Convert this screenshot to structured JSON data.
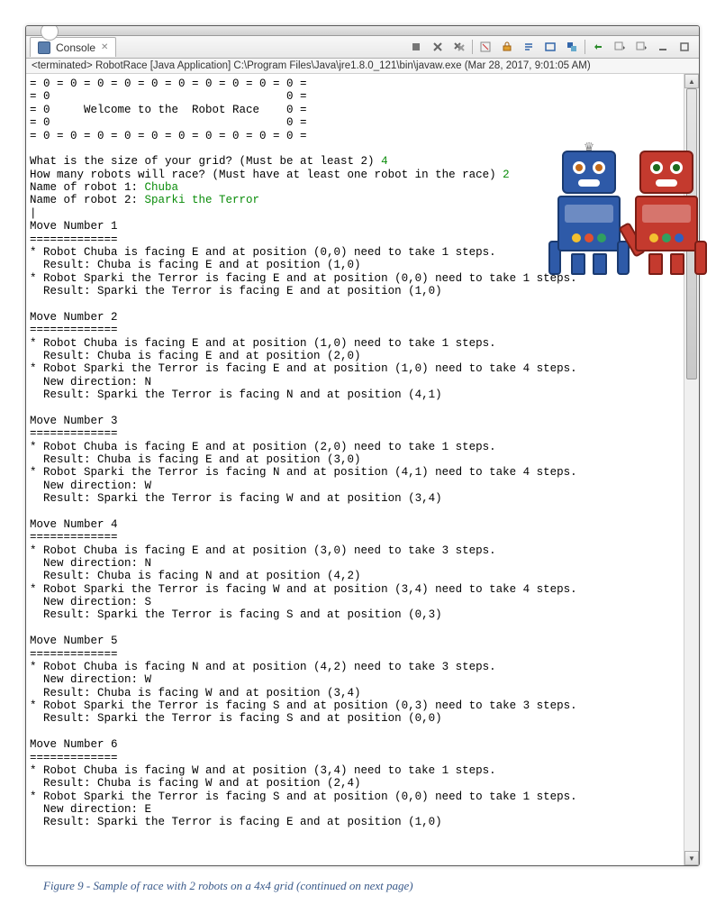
{
  "tab": {
    "label": "Console"
  },
  "process_line": "<terminated> RobotRace [Java Application] C:\\Program Files\\Java\\jre1.8.0_121\\bin\\javaw.exe (Mar 28, 2017, 9:01:05 AM)",
  "banner": {
    "l1": "= 0 = 0 = 0 = 0 = 0 = 0 = 0 = 0 = 0 = 0 =",
    "l2": "= 0                                   0 =",
    "l3": "= 0     Welcome to the  Robot Race    0 =",
    "l4": "= 0                                   0 =",
    "l5": "= 0 = 0 = 0 = 0 = 0 = 0 = 0 = 0 = 0 = 0 ="
  },
  "prompts": {
    "grid_q": "What is the size of your grid? (Must be at least 2) ",
    "grid_a": "4",
    "robots_q": "How many robots will race? (Must have at least one robot in the race) ",
    "robots_a": "2",
    "name1_q": "Name of robot 1: ",
    "name1_a": "Chuba",
    "name2_q": "Name of robot 2: ",
    "name2_a": "Sparki the Terror"
  },
  "cursor": "|",
  "sep": "=============",
  "moves": [
    {
      "title": "Move Number 1",
      "lines": [
        "* Robot Chuba is facing E and at position (0,0) need to take 1 steps.",
        "  Result: Chuba is facing E and at position (1,0)",
        "* Robot Sparki the Terror is facing E and at position (0,0) need to take 1 steps.",
        "  Result: Sparki the Terror is facing E and at position (1,0)"
      ]
    },
    {
      "title": "Move Number 2",
      "lines": [
        "* Robot Chuba is facing E and at position (1,0) need to take 1 steps.",
        "  Result: Chuba is facing E and at position (2,0)",
        "* Robot Sparki the Terror is facing E and at position (1,0) need to take 4 steps.",
        "  New direction: N",
        "  Result: Sparki the Terror is facing N and at position (4,1)"
      ]
    },
    {
      "title": "Move Number 3",
      "lines": [
        "* Robot Chuba is facing E and at position (2,0) need to take 1 steps.",
        "  Result: Chuba is facing E and at position (3,0)",
        "* Robot Sparki the Terror is facing N and at position (4,1) need to take 4 steps.",
        "  New direction: W",
        "  Result: Sparki the Terror is facing W and at position (3,4)"
      ]
    },
    {
      "title": "Move Number 4",
      "lines": [
        "* Robot Chuba is facing E and at position (3,0) need to take 3 steps.",
        "  New direction: N",
        "  Result: Chuba is facing N and at position (4,2)",
        "* Robot Sparki the Terror is facing W and at position (3,4) need to take 4 steps.",
        "  New direction: S",
        "  Result: Sparki the Terror is facing S and at position (0,3)"
      ]
    },
    {
      "title": "Move Number 5",
      "lines": [
        "* Robot Chuba is facing N and at position (4,2) need to take 3 steps.",
        "  New direction: W",
        "  Result: Chuba is facing W and at position (3,4)",
        "* Robot Sparki the Terror is facing S and at position (0,3) need to take 3 steps.",
        "  Result: Sparki the Terror is facing S and at position (0,0)"
      ]
    },
    {
      "title": "Move Number 6",
      "lines": [
        "* Robot Chuba is facing W and at position (3,4) need to take 1 steps.",
        "  Result: Chuba is facing W and at position (2,4)",
        "* Robot Sparki the Terror is facing S and at position (0,0) need to take 1 steps.",
        "  New direction: E",
        "  Result: Sparki the Terror is facing E and at position (1,0)"
      ]
    }
  ],
  "caption": "Figure 9 - Sample of race with 2 robots on a 4x4 grid (continued on next page)"
}
